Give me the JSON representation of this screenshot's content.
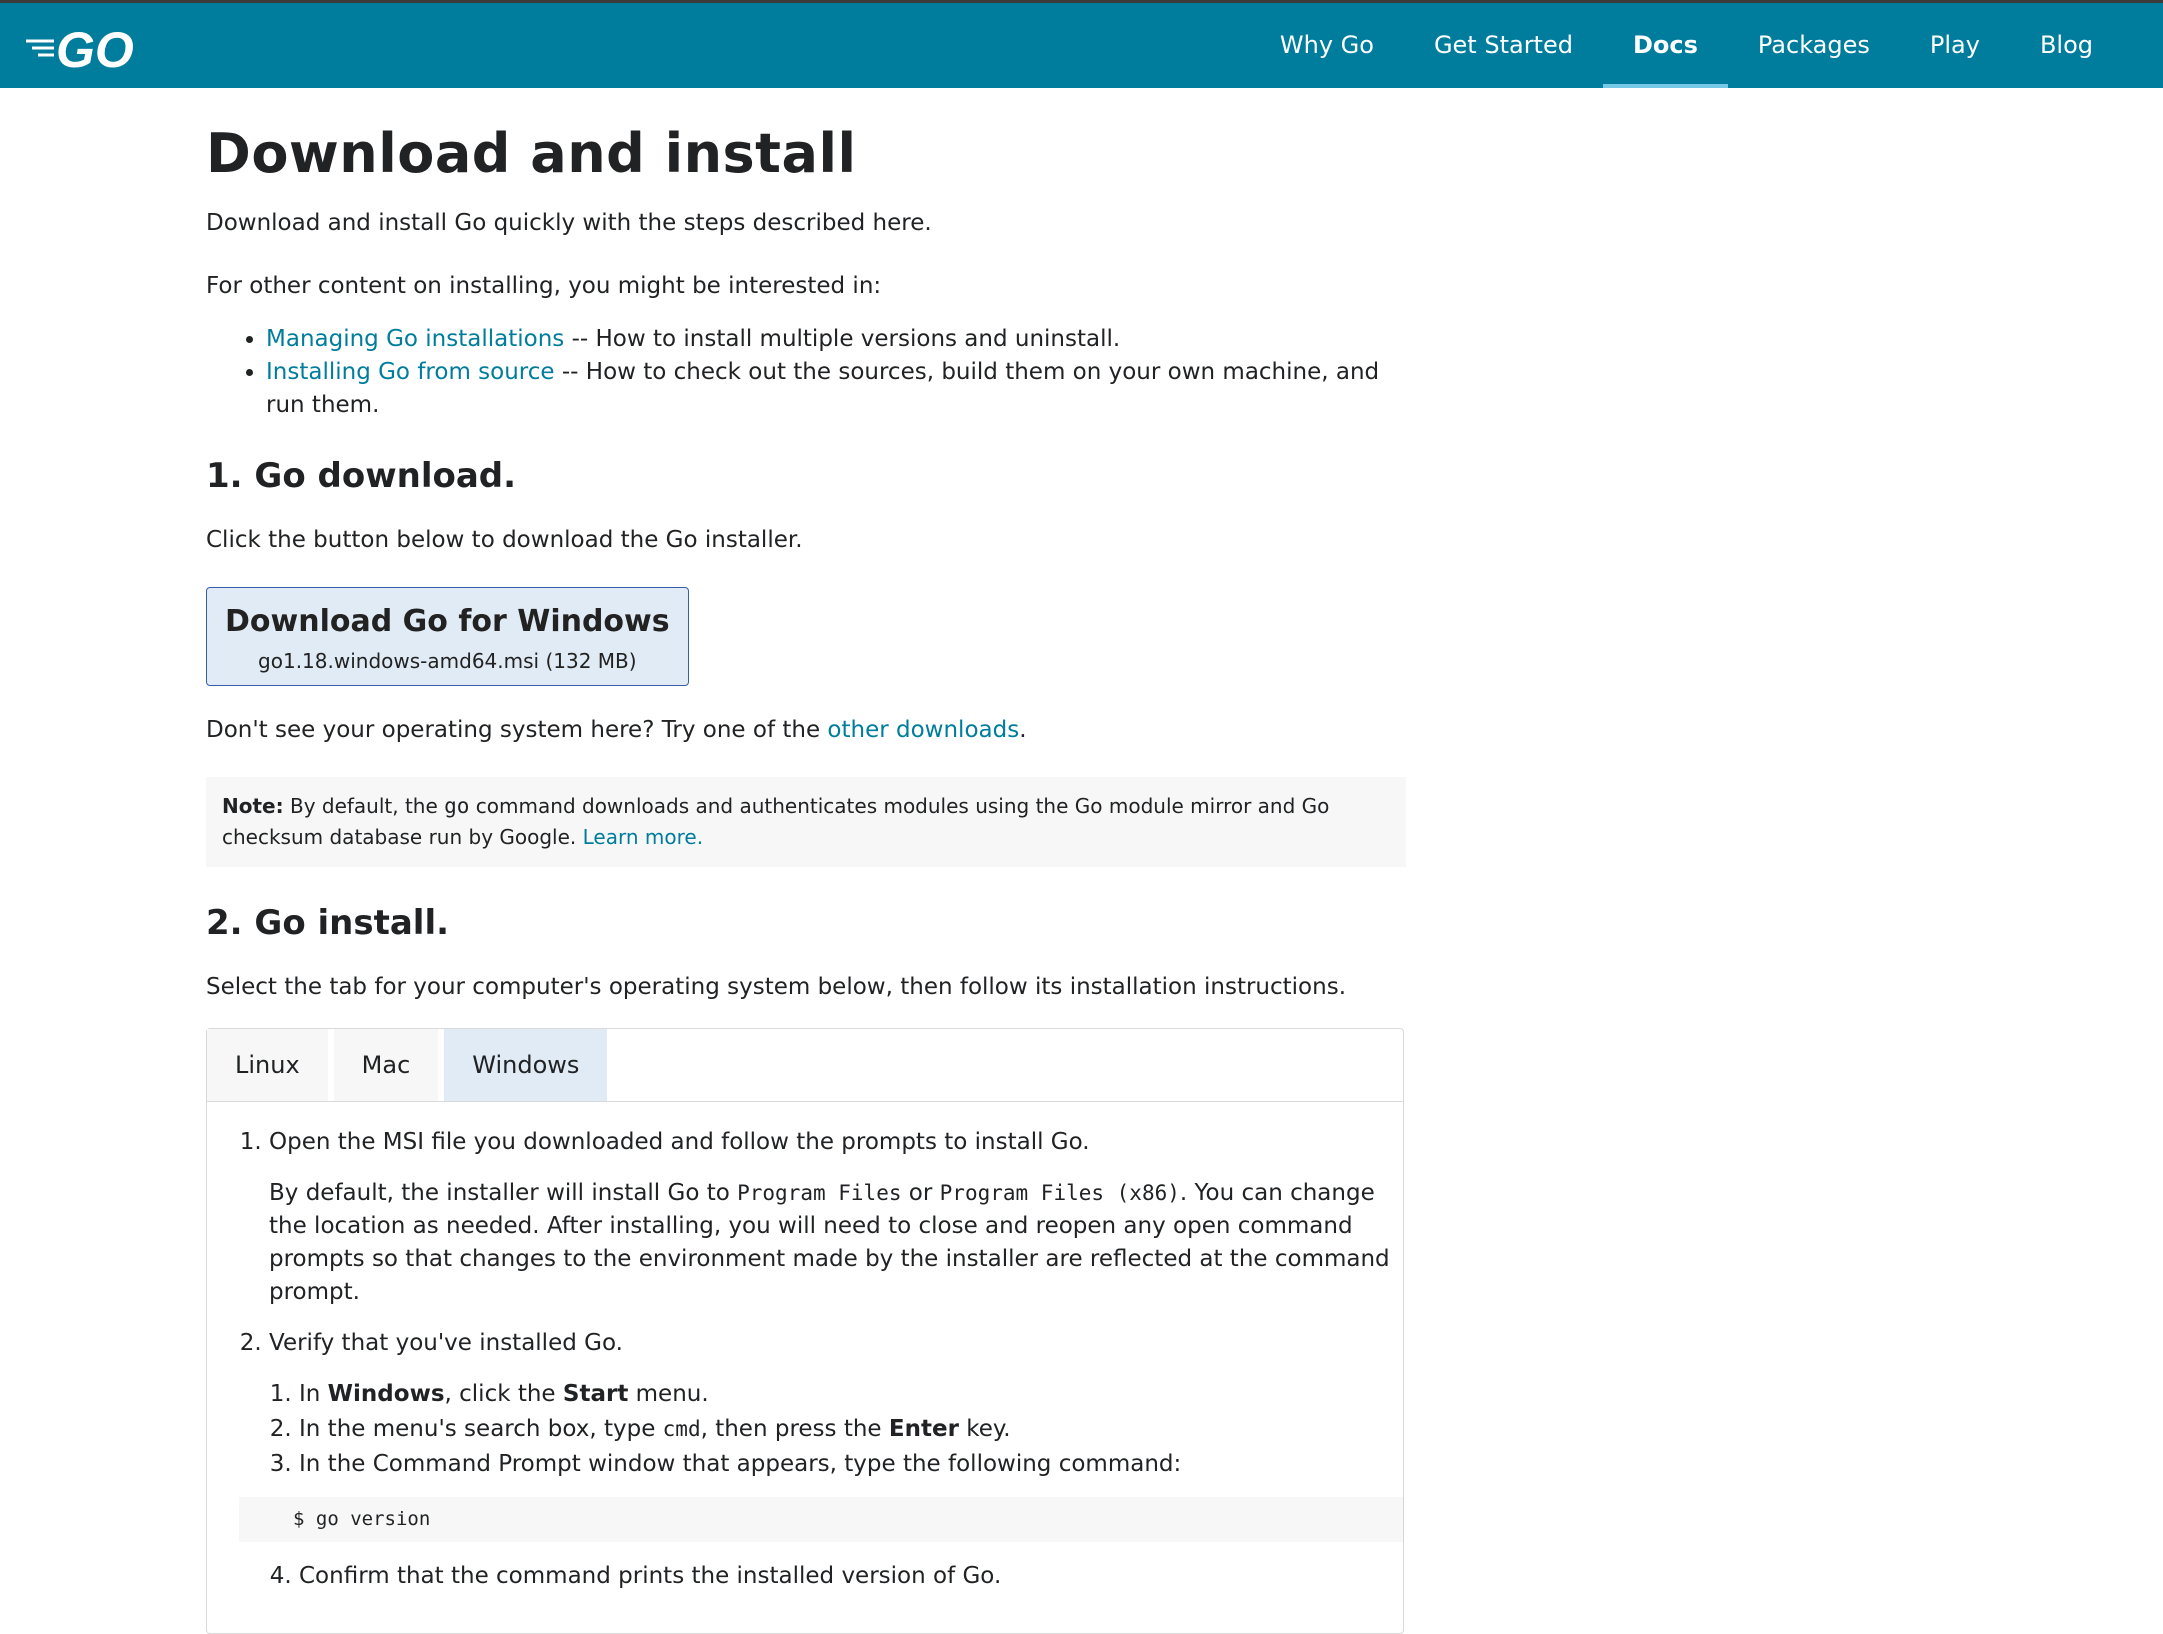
{
  "header": {
    "logo_text": "GO",
    "nav": [
      {
        "label": "Why Go"
      },
      {
        "label": "Get Started"
      },
      {
        "label": "Docs"
      },
      {
        "label": "Packages"
      },
      {
        "label": "Play"
      },
      {
        "label": "Blog"
      }
    ],
    "active_nav": "Docs",
    "bar_color": "#007d9c"
  },
  "page": {
    "title": "Download and install",
    "intro": "Download and install Go quickly with the steps described here.",
    "other_content": "For other content on installing, you might be interested in:",
    "links": [
      {
        "text": "Managing Go installations",
        "desc": " -- How to install multiple versions and uninstall."
      },
      {
        "text": "Installing Go from source",
        "desc": " -- How to check out the sources, build them on your own machine, and run them."
      }
    ]
  },
  "section1": {
    "heading": "1. Go download.",
    "instruction": "Click the button below to download the Go installer.",
    "button_title": "Download Go for Windows",
    "button_file": "go1.18.windows-amd64.msi (132 MB)",
    "other_prefix": "Don't see your operating system here? Try one of the ",
    "other_link": "other downloads",
    "other_suffix": ".",
    "note_label": "Note:",
    "note_pre": " By default, the ",
    "note_code": "go",
    "note_post": " command downloads and authenticates modules using the Go module mirror and Go checksum database run by Google. ",
    "note_link": "Learn more."
  },
  "section2": {
    "heading": "2. Go install.",
    "instruction": "Select the tab for your computer's operating system below, then follow its installation instructions.",
    "tabs": [
      "Linux",
      "Mac",
      "Windows"
    ],
    "active_tab": "Windows",
    "step1": "Open the MSI file you downloaded and follow the prompts to install Go.",
    "step1_detail_a": "By default, the installer will install Go to ",
    "step1_code1": "Program Files",
    "step1_detail_b": " or ",
    "step1_code2": "Program Files (x86)",
    "step1_detail_c": ". You can change the location as needed. After installing, you will need to close and reopen any open command prompts so that changes to the environment made by the installer are reflected at the command prompt.",
    "step2": "Verify that you've installed Go.",
    "sub1_a": "In ",
    "sub1_b": "Windows",
    "sub1_c": ", click the ",
    "sub1_d": "Start",
    "sub1_e": " menu.",
    "sub2_a": "In the menu's search box, type ",
    "sub2_code": "cmd",
    "sub2_b": ", then press the ",
    "sub2_c": "Enter",
    "sub2_d": " key.",
    "sub3": "In the Command Prompt window that appears, type the following command:",
    "command": "$ go version",
    "sub4": "Confirm that the command prints the installed version of Go."
  }
}
